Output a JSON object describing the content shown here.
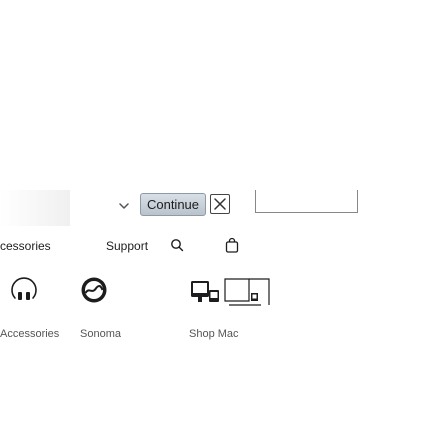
{
  "top_bar": {
    "continue_label": "Continue"
  },
  "nav": {
    "accessories_label": "cessories",
    "support_label": "Support"
  },
  "tiles": [
    {
      "label": "Accessories",
      "icon": "wireless-icon"
    },
    {
      "label": "Sonoma",
      "icon": "macos-sonoma-icon"
    },
    {
      "label": "Shop Mac",
      "icon": "mac-devices-icon"
    }
  ],
  "icons": {
    "chevron": "chevron-down-icon",
    "close": "close-icon",
    "search": "search-icon",
    "bag": "bag-icon"
  }
}
